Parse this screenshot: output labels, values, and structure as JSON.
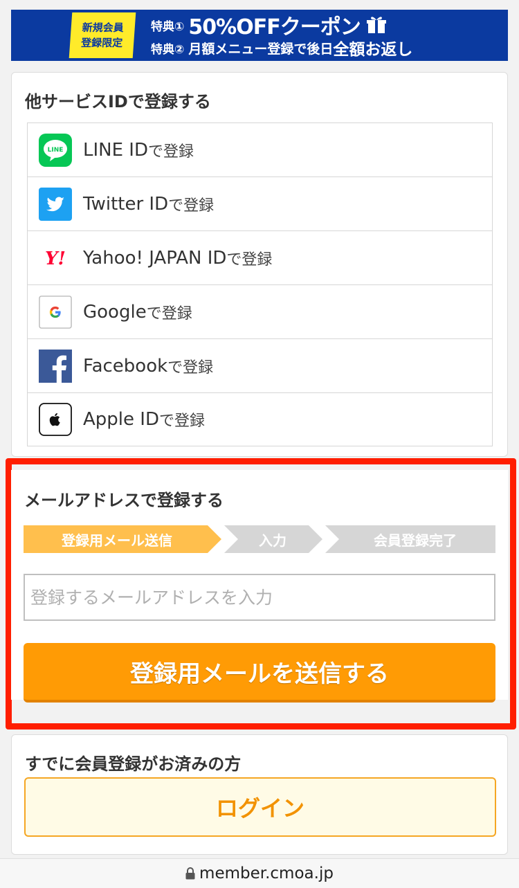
{
  "banner": {
    "tag_line1": "新規会員",
    "tag_line2": "登録限定",
    "perk1_label": "特典①",
    "perk1_text": "50%OFFクーポン",
    "perk2_label": "特典②",
    "perk2_text": "月額メニュー登録で後日",
    "perk2_em": "全額お返し"
  },
  "social": {
    "title": "他サービスIDで登録する",
    "suffix": "で登録",
    "items": [
      {
        "name": "LINE ID",
        "icon": "line-icon"
      },
      {
        "name": "Twitter ID",
        "icon": "twitter-icon"
      },
      {
        "name": "Yahoo! JAPAN ID",
        "icon": "yahoo-icon"
      },
      {
        "name": "Google",
        "icon": "google-icon"
      },
      {
        "name": "Facebook",
        "icon": "facebook-icon"
      },
      {
        "name": "Apple ID",
        "icon": "apple-icon"
      }
    ]
  },
  "email": {
    "title": "メールアドレスで登録する",
    "steps": [
      "登録用メール送信",
      "入力",
      "会員登録完了"
    ],
    "input_placeholder": "登録するメールアドレスを入力",
    "input_value": "",
    "submit_label": "登録用メールを送信する"
  },
  "login": {
    "title": "すでに会員登録がお済みの方",
    "button_label": "ログイン"
  },
  "address_bar": {
    "url": "member.cmoa.jp"
  },
  "colors": {
    "banner_bg": "#0b3aa0",
    "banner_tag": "#ffeb2a",
    "highlight_frame": "#ff1e00",
    "primary_button": "#ff9b05",
    "step_active": "#ffbf4d",
    "step_inactive": "#d6d6d6",
    "login_border": "#f5a623"
  }
}
